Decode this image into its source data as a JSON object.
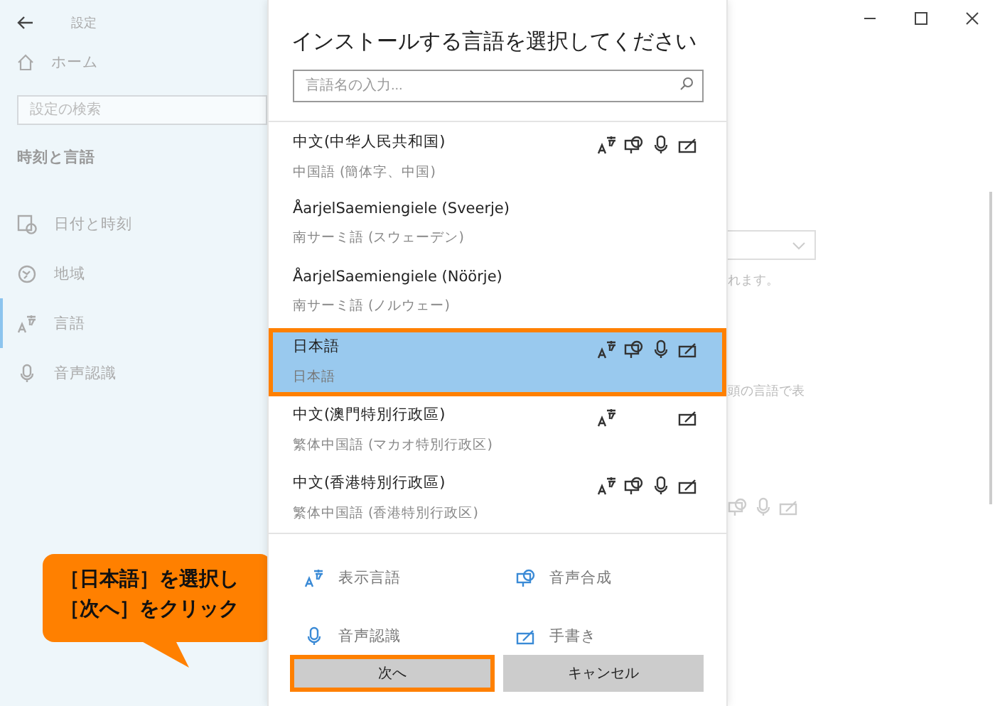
{
  "sidebar": {
    "title": "設定",
    "home": "ホーム",
    "search": {
      "placeholder": "設定の検索"
    },
    "section": "時刻と言語",
    "items": [
      {
        "kind": "clock",
        "label": "日付と時刻",
        "selected": false
      },
      {
        "kind": "globe",
        "label": "地域",
        "selected": false
      },
      {
        "kind": "language",
        "label": "言語",
        "selected": true
      },
      {
        "kind": "mic",
        "label": "音声認識",
        "selected": false
      }
    ]
  },
  "dialog": {
    "title": "インストールする言語を選択してください",
    "search": {
      "placeholder": "言語名の入力..."
    },
    "languages": [
      {
        "name": "中文(中华人民共和国)",
        "native": "中国語 (簡体字、中国)",
        "selected": false,
        "display": true,
        "tts": true,
        "speech": true,
        "handwriting": true
      },
      {
        "name": "ÅarjelSaemiengiele (Sveerje)",
        "native": "南サーミ語 (スウェーデン)",
        "selected": false,
        "display": false,
        "tts": false,
        "speech": false,
        "handwriting": false
      },
      {
        "name": "ÅarjelSaemiengiele (Nöörje)",
        "native": "南サーミ語 (ノルウェー)",
        "selected": false,
        "display": false,
        "tts": false,
        "speech": false,
        "handwriting": false
      },
      {
        "name": "日本語",
        "native": "日本語",
        "selected": true,
        "display": true,
        "tts": true,
        "speech": true,
        "handwriting": true
      },
      {
        "name": "中文(澳門特別行政區)",
        "native": "繁体中国語 (マカオ特別行政区)",
        "selected": false,
        "display": true,
        "tts": false,
        "speech": false,
        "handwriting": true
      },
      {
        "name": "中文(香港特別行政區)",
        "native": "繁体中国語 (香港特別行政区)",
        "selected": false,
        "display": true,
        "tts": true,
        "speech": true,
        "handwriting": true
      }
    ],
    "legend": [
      {
        "kind": "display",
        "label": "表示言語"
      },
      {
        "kind": "tts",
        "label": "音声合成"
      },
      {
        "kind": "speech",
        "label": "音声認識"
      },
      {
        "kind": "handwriting",
        "label": "手書き"
      }
    ],
    "buttons": [
      {
        "label": "次へ",
        "highlighted": true
      },
      {
        "label": "キャンセル",
        "highlighted": false
      }
    ]
  },
  "background": {
    "text_1": "れます。",
    "text_2": "頭の言語で表"
  },
  "callout": {
    "lines": [
      "［日本語］を選択し",
      "［次へ］をクリック"
    ]
  }
}
